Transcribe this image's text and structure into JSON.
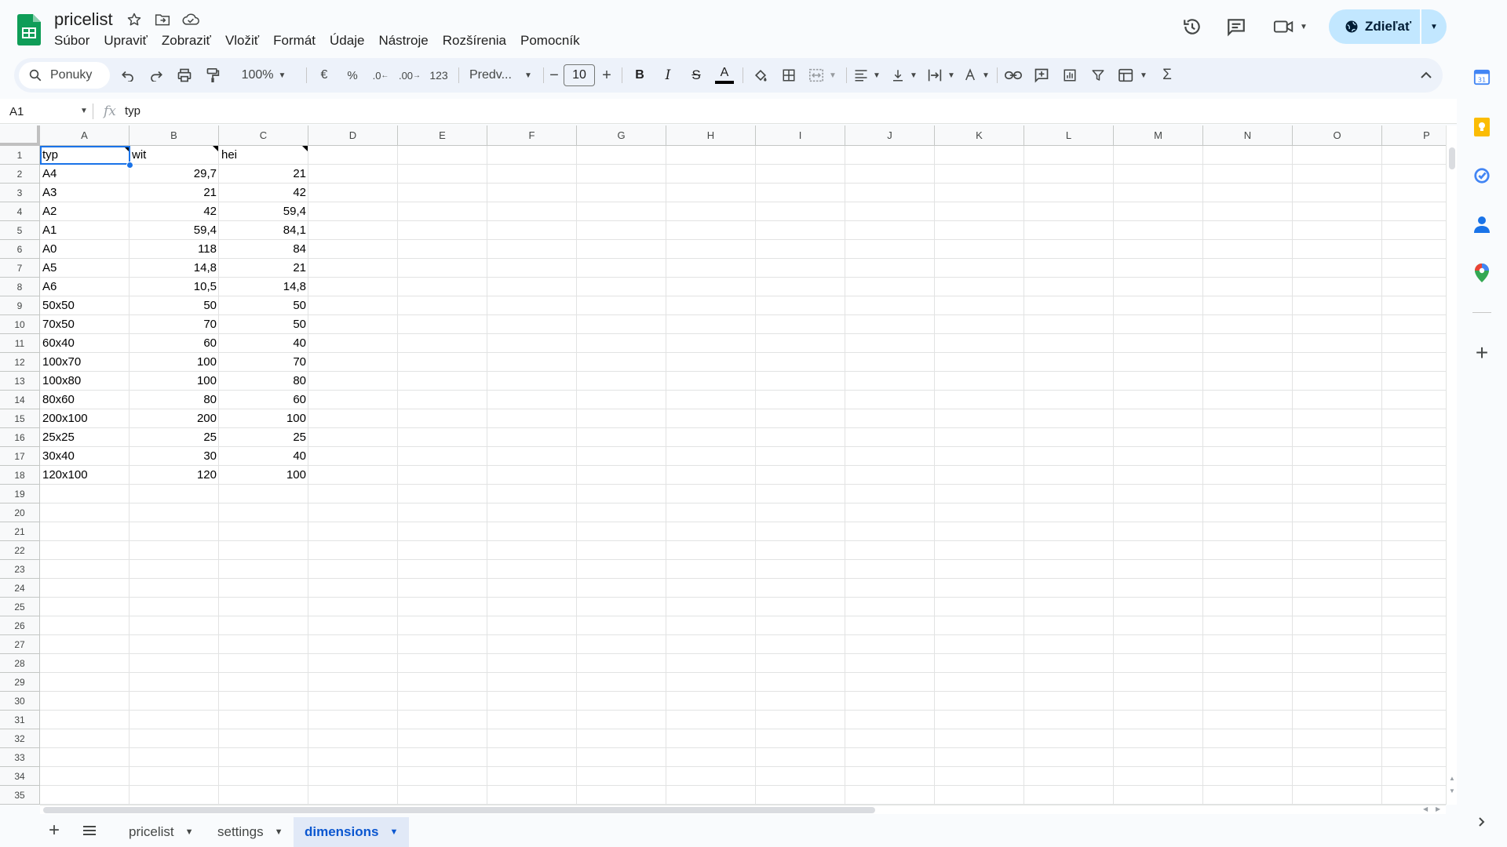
{
  "document": {
    "title": "pricelist"
  },
  "menu": [
    "Súbor",
    "Upraviť",
    "Zobraziť",
    "Vložiť",
    "Formát",
    "Údaje",
    "Nástroje",
    "Rozšírenia",
    "Pomocník"
  ],
  "share": {
    "label": "Zdieľať"
  },
  "toolbar": {
    "search_label": "Ponuky",
    "zoom": "100%",
    "currency": "€",
    "percent": "%",
    "decrease_decimal": ".0",
    "increase_decimal": ".00",
    "number_format": "123",
    "font": "Predv...",
    "font_size": "10",
    "minus": "−",
    "plus": "+",
    "bold": "B",
    "italic": "I",
    "strike": "S",
    "text_color": "A",
    "sum": "Σ"
  },
  "formula_bar": {
    "cell_ref": "A1",
    "fx": "fx",
    "value": "typ"
  },
  "columns": [
    "A",
    "B",
    "C",
    "D",
    "E",
    "F",
    "G",
    "H",
    "I",
    "J",
    "K",
    "L",
    "M",
    "N",
    "O",
    "P"
  ],
  "row_count": 35,
  "table": {
    "headers": [
      "typ",
      "wit",
      "hei"
    ],
    "rows": [
      [
        "A4",
        "29,7",
        "21"
      ],
      [
        "A3",
        "21",
        "42"
      ],
      [
        "A2",
        "42",
        "59,4"
      ],
      [
        "A1",
        "59,4",
        "84,1"
      ],
      [
        "A0",
        "118",
        "84"
      ],
      [
        "A5",
        "14,8",
        "21"
      ],
      [
        "A6",
        "10,5",
        "14,8"
      ],
      [
        "50x50",
        "50",
        "50"
      ],
      [
        "70x50",
        "70",
        "50"
      ],
      [
        "60x40",
        "60",
        "40"
      ],
      [
        "100x70",
        "100",
        "70"
      ],
      [
        "100x80",
        "100",
        "80"
      ],
      [
        "80x60",
        "80",
        "60"
      ],
      [
        "200x100",
        "200",
        "100"
      ],
      [
        "25x25",
        "25",
        "25"
      ],
      [
        "30x40",
        "30",
        "40"
      ],
      [
        "120x100",
        "120",
        "100"
      ]
    ]
  },
  "sheets": [
    {
      "label": "pricelist",
      "active": false
    },
    {
      "label": "settings",
      "active": false
    },
    {
      "label": "dimensions",
      "active": true
    }
  ],
  "colors": {
    "accent": "#1a73e8",
    "share_bg": "#c2e7ff",
    "active_tab_bg": "#e1e9f7",
    "active_tab_text": "#0b57d0",
    "toolbar_bg": "#edf2fa"
  }
}
